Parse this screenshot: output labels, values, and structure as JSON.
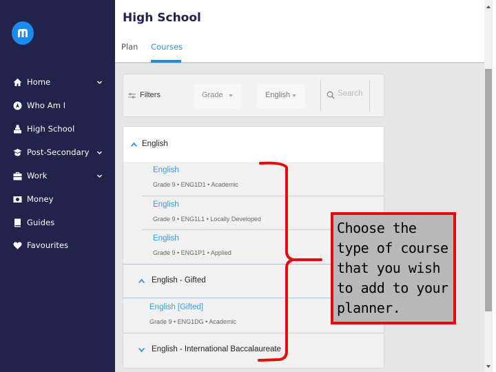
{
  "sidebar": {
    "logo_icon": "myblueprint-logo-icon",
    "items": [
      {
        "label": "Home",
        "icon": "home-icon",
        "has_chevron": true
      },
      {
        "label": "Who Am I",
        "icon": "compass-icon",
        "has_chevron": false
      },
      {
        "label": "High School",
        "icon": "school-icon",
        "has_chevron": false
      },
      {
        "label": "Post-Secondary",
        "icon": "graduation-cap-icon",
        "has_chevron": true
      },
      {
        "label": "Work",
        "icon": "briefcase-icon",
        "has_chevron": true
      },
      {
        "label": "Money",
        "icon": "money-icon",
        "has_chevron": false
      },
      {
        "label": "Guides",
        "icon": "book-icon",
        "has_chevron": false
      },
      {
        "label": "Favourites",
        "icon": "heart-icon",
        "has_chevron": false
      }
    ]
  },
  "header": {
    "title": "High School",
    "tabs": [
      {
        "label": "Plan",
        "active": false
      },
      {
        "label": "Courses",
        "active": true
      }
    ]
  },
  "filters": {
    "label": "Filters",
    "grade_select": {
      "value": "Grade"
    },
    "subject_select": {
      "value": "English"
    },
    "search": {
      "placeholder": "Search",
      "value": ""
    }
  },
  "course_groups": [
    {
      "label": "English",
      "expanded": true,
      "courses": [
        {
          "title": "English",
          "meta": "Grade 9 • ENG1D1 • Academic"
        },
        {
          "title": "English",
          "meta": "Grade 9 • ENG1L1 • Locally Developed"
        },
        {
          "title": "English",
          "meta": "Grade 9 • ENG1P1 • Applied"
        }
      ]
    },
    {
      "label": "English - Gifted",
      "expanded": true,
      "courses": [
        {
          "title": "English [Gifted]",
          "meta": "Grade 9 • ENG1DG • Academic"
        }
      ]
    },
    {
      "label": "English - International Baccalaureate",
      "expanded": false,
      "courses": []
    }
  ],
  "annotation": {
    "text": "Choose the type of course that you wish to add to your planner.",
    "lines": [
      "Choose the",
      "type of course",
      "that you wish",
      "to add to your",
      "planner."
    ],
    "border_color": "#e30b0b",
    "background_color": "#b8b8b8"
  },
  "colors": {
    "sidebar_bg": "#23224a",
    "accent": "#1f8ce0",
    "link": "#3a9ad6",
    "annotation_red": "#e30b0b"
  }
}
